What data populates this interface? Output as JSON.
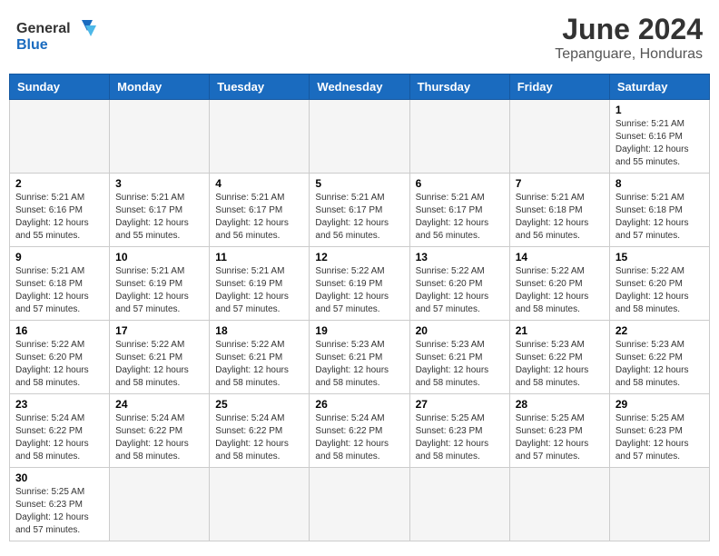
{
  "header": {
    "logo_general": "General",
    "logo_blue": "Blue",
    "month_year": "June 2024",
    "location": "Tepanguare, Honduras"
  },
  "weekdays": [
    "Sunday",
    "Monday",
    "Tuesday",
    "Wednesday",
    "Thursday",
    "Friday",
    "Saturday"
  ],
  "weeks": [
    [
      {
        "day": "",
        "info": ""
      },
      {
        "day": "",
        "info": ""
      },
      {
        "day": "",
        "info": ""
      },
      {
        "day": "",
        "info": ""
      },
      {
        "day": "",
        "info": ""
      },
      {
        "day": "",
        "info": ""
      },
      {
        "day": "1",
        "info": "Sunrise: 5:21 AM\nSunset: 6:16 PM\nDaylight: 12 hours\nand 55 minutes."
      }
    ],
    [
      {
        "day": "2",
        "info": "Sunrise: 5:21 AM\nSunset: 6:16 PM\nDaylight: 12 hours\nand 55 minutes."
      },
      {
        "day": "3",
        "info": "Sunrise: 5:21 AM\nSunset: 6:17 PM\nDaylight: 12 hours\nand 55 minutes."
      },
      {
        "day": "4",
        "info": "Sunrise: 5:21 AM\nSunset: 6:17 PM\nDaylight: 12 hours\nand 56 minutes."
      },
      {
        "day": "5",
        "info": "Sunrise: 5:21 AM\nSunset: 6:17 PM\nDaylight: 12 hours\nand 56 minutes."
      },
      {
        "day": "6",
        "info": "Sunrise: 5:21 AM\nSunset: 6:17 PM\nDaylight: 12 hours\nand 56 minutes."
      },
      {
        "day": "7",
        "info": "Sunrise: 5:21 AM\nSunset: 6:18 PM\nDaylight: 12 hours\nand 56 minutes."
      },
      {
        "day": "8",
        "info": "Sunrise: 5:21 AM\nSunset: 6:18 PM\nDaylight: 12 hours\nand 57 minutes."
      }
    ],
    [
      {
        "day": "9",
        "info": "Sunrise: 5:21 AM\nSunset: 6:18 PM\nDaylight: 12 hours\nand 57 minutes."
      },
      {
        "day": "10",
        "info": "Sunrise: 5:21 AM\nSunset: 6:19 PM\nDaylight: 12 hours\nand 57 minutes."
      },
      {
        "day": "11",
        "info": "Sunrise: 5:21 AM\nSunset: 6:19 PM\nDaylight: 12 hours\nand 57 minutes."
      },
      {
        "day": "12",
        "info": "Sunrise: 5:22 AM\nSunset: 6:19 PM\nDaylight: 12 hours\nand 57 minutes."
      },
      {
        "day": "13",
        "info": "Sunrise: 5:22 AM\nSunset: 6:20 PM\nDaylight: 12 hours\nand 57 minutes."
      },
      {
        "day": "14",
        "info": "Sunrise: 5:22 AM\nSunset: 6:20 PM\nDaylight: 12 hours\nand 58 minutes."
      },
      {
        "day": "15",
        "info": "Sunrise: 5:22 AM\nSunset: 6:20 PM\nDaylight: 12 hours\nand 58 minutes."
      }
    ],
    [
      {
        "day": "16",
        "info": "Sunrise: 5:22 AM\nSunset: 6:20 PM\nDaylight: 12 hours\nand 58 minutes."
      },
      {
        "day": "17",
        "info": "Sunrise: 5:22 AM\nSunset: 6:21 PM\nDaylight: 12 hours\nand 58 minutes."
      },
      {
        "day": "18",
        "info": "Sunrise: 5:22 AM\nSunset: 6:21 PM\nDaylight: 12 hours\nand 58 minutes."
      },
      {
        "day": "19",
        "info": "Sunrise: 5:23 AM\nSunset: 6:21 PM\nDaylight: 12 hours\nand 58 minutes."
      },
      {
        "day": "20",
        "info": "Sunrise: 5:23 AM\nSunset: 6:21 PM\nDaylight: 12 hours\nand 58 minutes."
      },
      {
        "day": "21",
        "info": "Sunrise: 5:23 AM\nSunset: 6:22 PM\nDaylight: 12 hours\nand 58 minutes."
      },
      {
        "day": "22",
        "info": "Sunrise: 5:23 AM\nSunset: 6:22 PM\nDaylight: 12 hours\nand 58 minutes."
      }
    ],
    [
      {
        "day": "23",
        "info": "Sunrise: 5:24 AM\nSunset: 6:22 PM\nDaylight: 12 hours\nand 58 minutes."
      },
      {
        "day": "24",
        "info": "Sunrise: 5:24 AM\nSunset: 6:22 PM\nDaylight: 12 hours\nand 58 minutes."
      },
      {
        "day": "25",
        "info": "Sunrise: 5:24 AM\nSunset: 6:22 PM\nDaylight: 12 hours\nand 58 minutes."
      },
      {
        "day": "26",
        "info": "Sunrise: 5:24 AM\nSunset: 6:22 PM\nDaylight: 12 hours\nand 58 minutes."
      },
      {
        "day": "27",
        "info": "Sunrise: 5:25 AM\nSunset: 6:23 PM\nDaylight: 12 hours\nand 58 minutes."
      },
      {
        "day": "28",
        "info": "Sunrise: 5:25 AM\nSunset: 6:23 PM\nDaylight: 12 hours\nand 57 minutes."
      },
      {
        "day": "29",
        "info": "Sunrise: 5:25 AM\nSunset: 6:23 PM\nDaylight: 12 hours\nand 57 minutes."
      }
    ],
    [
      {
        "day": "30",
        "info": "Sunrise: 5:25 AM\nSunset: 6:23 PM\nDaylight: 12 hours\nand 57 minutes."
      },
      {
        "day": "",
        "info": ""
      },
      {
        "day": "",
        "info": ""
      },
      {
        "day": "",
        "info": ""
      },
      {
        "day": "",
        "info": ""
      },
      {
        "day": "",
        "info": ""
      },
      {
        "day": "",
        "info": ""
      }
    ]
  ]
}
